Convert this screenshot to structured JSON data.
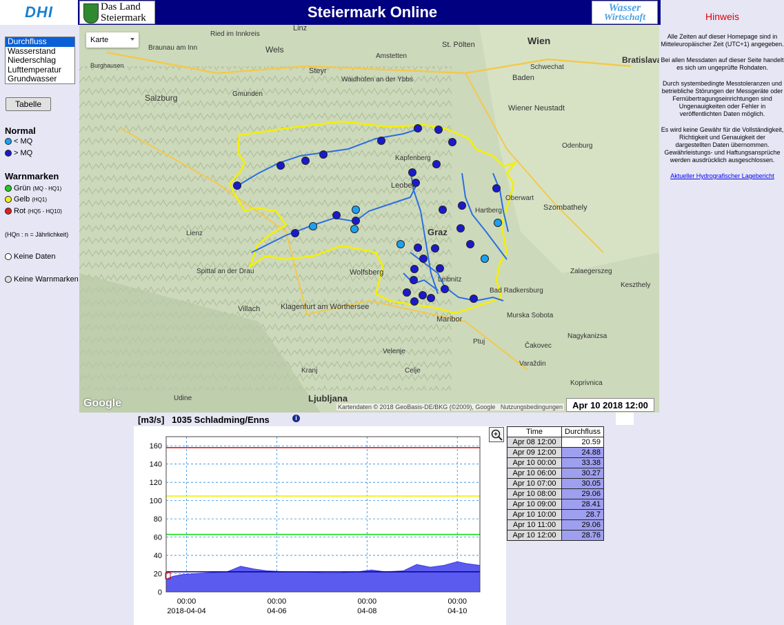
{
  "header": {
    "title": "Steiermark Online",
    "logo_left": "DHI",
    "logo_land_line1": "Das Land",
    "logo_land_line2": "Steiermark",
    "logo_right_line1": "Wasser",
    "logo_right_line2": "Wirtschaft",
    "hinweis_heading": "Hinweis"
  },
  "parameters": [
    "Durchfluss",
    "Wasserstand",
    "Niederschlag",
    "Lufttemperatur",
    "Grundwasser"
  ],
  "selected_parameter": "Durchfluss",
  "tabelle_button": "Tabelle",
  "legend": {
    "normal_heading": "Normal",
    "normal_items": [
      {
        "label": "< MQ",
        "color": "#1ea0f0"
      },
      {
        "label": "> MQ",
        "color": "#1a1acc"
      }
    ],
    "warn_heading": "Warnmarken",
    "warn_items": [
      {
        "label": "Grün",
        "sub": "(MQ - HQ1)",
        "color": "#22cc22"
      },
      {
        "label": "Gelb",
        "sub": "(HQ1)",
        "color": "#eeee22"
      },
      {
        "label": "Rot",
        "sub": "(HQ5 - HQ10)",
        "color": "#dd2222"
      }
    ],
    "hqn_note": "(HQn : n = Jährlichkeit)",
    "keine_daten": "Keine Daten",
    "keine_warnmarken": "Keine Warnmarken"
  },
  "map": {
    "type_select": "Karte",
    "labels": [
      "Wels",
      "Steyr",
      "St. Pölten",
      "Wien",
      "Bratislava",
      "Salzburg",
      "Baden",
      "Wiener Neustadt",
      "Leoben",
      "Graz",
      "Hartberg",
      "Szombathely",
      "Oberwart",
      "Wolfsberg",
      "Klagenfurt am Wörthersee",
      "Villach",
      "Maribor",
      "Ptuj",
      "Ljubljana",
      "Murska Sobota",
      "Zalaegerszeg",
      "Keszthely",
      "Nagykanizsa",
      "Čakovec",
      "Varaždin",
      "Celje",
      "Velenje",
      "Kranj",
      "Koprivnica",
      "Udine",
      "Gmunden",
      "Lienz",
      "Linz",
      "Schwechat",
      "Odenburg",
      "Burghausen",
      "Braunau am Inn",
      "Ried im Innkreis",
      "Spittal an der Drau",
      "Leibnitz",
      "Bad Radkersburg",
      "Kapfenberg",
      "Amstetten",
      "Waidhofen an der Ybbs"
    ],
    "google_text": "Google",
    "credit": "Kartendaten © 2018 GeoBasis-DE/BKG (©2009), Google",
    "terms": "Nutzungsbedingungen",
    "timestamp": "Apr 10 2018 12:00"
  },
  "hinweis_paragraphs": [
    "Alle Zeiten auf dieser Homepage sind in Mitteleuropäischer Zeit (UTC+1) angegeben.",
    "Bei allen Messdaten auf dieser Seite handelt es sich um ungeprüfte Rohdaten.",
    "Durch systembedingte Messtoleranzen und betriebliche Störungen der Messgeräte oder Fernübertragungseinrichtungen sind Ungenauigkeiten oder Fehler in veröffentlichten Daten möglich.",
    "Es wird keine Gewähr für die Vollständigkeit, Richtigkeit und Genauigkeit der dargestellten Daten übernommen. Gewährleistungs- und Haftungsansprüche werden ausdrücklich ausgeschlossen."
  ],
  "hinweis_link": "Aktueller Hydrografischer Lagebericht",
  "chart": {
    "unit": "[m3/s]",
    "station": "1035 Schladming/Enns"
  },
  "chart_data": {
    "type": "area",
    "title": "1035 Schladming/Enns",
    "ylabel": "[m3/s]",
    "ylim": [
      0,
      170
    ],
    "yticks": [
      0,
      20,
      40,
      60,
      80,
      100,
      120,
      140,
      160
    ],
    "xticks": [
      {
        "time": "00:00",
        "date": "2018-04-04",
        "day": 0
      },
      {
        "time": "00:00",
        "date": "04-06",
        "day": 2
      },
      {
        "time": "00:00",
        "date": "04-08",
        "day": 4
      },
      {
        "time": "00:00",
        "date": "04-10",
        "day": 6
      }
    ],
    "xlim_days": [
      -0.45,
      6.5
    ],
    "threshold_lines": [
      {
        "name": "Rot",
        "value": 158,
        "color": "#e00000"
      },
      {
        "name": "Gelb",
        "value": 105,
        "color": "#f0f000"
      },
      {
        "name": "Grün",
        "value": 63,
        "color": "#00e000"
      },
      {
        "name": "MQ",
        "value": 22,
        "color": "#000099"
      }
    ],
    "series": [
      {
        "x_days": [
          -0.45,
          -0.3,
          -0.1,
          0.2,
          0.5,
          0.9,
          1.2,
          1.5,
          1.8,
          2.2,
          2.6,
          3.0,
          3.4,
          3.8,
          4.1,
          4.4,
          4.8,
          5.1,
          5.4,
          5.7,
          6.0,
          6.2,
          6.5
        ],
        "values": [
          14,
          17,
          19,
          20,
          21,
          22,
          28,
          25,
          23,
          22,
          22,
          21,
          21,
          22,
          24,
          22,
          23,
          30,
          27,
          29,
          33,
          31,
          29
        ]
      }
    ]
  },
  "table": {
    "headers": [
      "Time",
      "Durchfluss"
    ],
    "rows": [
      [
        "Apr 08 12:00",
        "20.59"
      ],
      [
        "Apr 09 12:00",
        "24.88"
      ],
      [
        "Apr 10 00:00",
        "33.38"
      ],
      [
        "Apr 10 06:00",
        "30.27"
      ],
      [
        "Apr 10 07:00",
        "30.05"
      ],
      [
        "Apr 10 08:00",
        "29.06"
      ],
      [
        "Apr 10 09:00",
        "28.41"
      ],
      [
        "Apr 10 10:00",
        "28.7"
      ],
      [
        "Apr 10 11:00",
        "29.06"
      ],
      [
        "Apr 10 12:00",
        "28.76"
      ]
    ]
  }
}
